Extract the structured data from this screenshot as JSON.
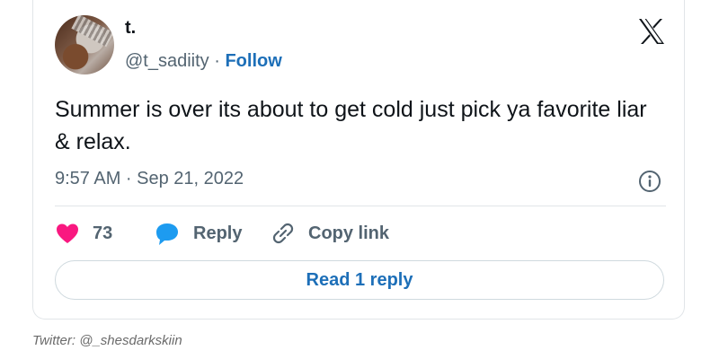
{
  "tweet": {
    "author_name": "t.",
    "handle": "@t_sadiity",
    "separator": "·",
    "follow_label": "Follow",
    "text": "Summer is over its about to get cold just pick ya favorite liar & relax.",
    "timestamp": "9:57 AM · Sep 21, 2022"
  },
  "actions": {
    "like_count": "73",
    "reply_label": "Reply",
    "copy_link_label": "Copy link"
  },
  "read_reply_label": "Read 1 reply",
  "caption": "Twitter: @_shesdarkskiin",
  "icons": {
    "brand": "x-logo-icon",
    "info": "info-icon",
    "like": "heart-icon",
    "reply": "speech-bubble-icon",
    "copy": "link-icon"
  },
  "colors": {
    "heart": "#f91880",
    "reply_bubble": "#1d9bf0",
    "link_blue": "#1d6fb8",
    "text_primary": "#0f1419",
    "text_secondary": "#536471"
  }
}
